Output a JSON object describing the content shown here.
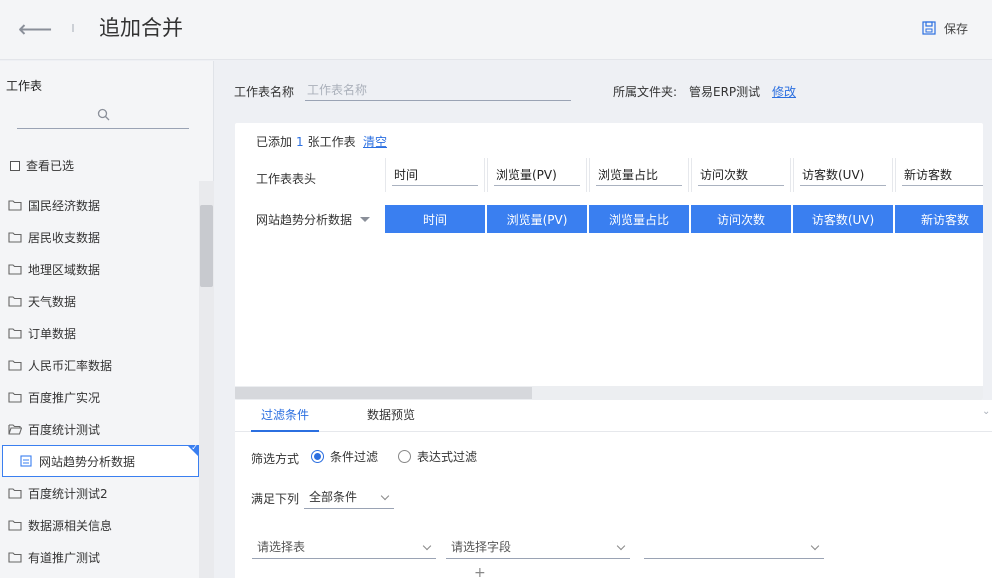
{
  "header": {
    "title": "追加合并",
    "save_label": "保存"
  },
  "sidebar": {
    "title": "工作表",
    "view_checked_label": "查看已选",
    "items": [
      {
        "label": "国民经济数据",
        "type": "folder"
      },
      {
        "label": "居民收支数据",
        "type": "folder"
      },
      {
        "label": "地理区域数据",
        "type": "folder"
      },
      {
        "label": "天气数据",
        "type": "folder"
      },
      {
        "label": "订单数据",
        "type": "folder"
      },
      {
        "label": "人民币汇率数据",
        "type": "folder"
      },
      {
        "label": "百度推广实况",
        "type": "folder"
      },
      {
        "label": "百度统计测试",
        "type": "folder-open"
      },
      {
        "label": "网站趋势分析数据",
        "type": "sheet",
        "selected": true
      },
      {
        "label": "百度统计测试2",
        "type": "folder"
      },
      {
        "label": "数据源相关信息",
        "type": "folder"
      },
      {
        "label": "有道推广测试",
        "type": "folder"
      }
    ]
  },
  "form": {
    "name_label": "工作表名称",
    "name_placeholder": "工作表名称",
    "folder_label": "所属文件夹:",
    "folder_name": "管易ERP测试",
    "folder_edit": "修改"
  },
  "merge": {
    "added_prefix": "已添加",
    "added_count": "1",
    "added_suffix": "张工作表",
    "clear_label": "清空",
    "header_label": "工作表表头",
    "header_columns": [
      "时间",
      "浏览量(PV)",
      "浏览量占比",
      "访问次数",
      "访客数(UV)",
      "新访客数"
    ],
    "sheet_name": "网站趋势分析数据",
    "sheet_fields": [
      "时间",
      "浏览量(PV)",
      "浏览量占比",
      "访问次数",
      "访客数(UV)",
      "新访客数"
    ]
  },
  "tabs": {
    "filter": "过滤条件",
    "preview": "数据预览"
  },
  "filter": {
    "mode_label": "筛选方式",
    "mode_condition": "条件过滤",
    "mode_expression": "表达式过滤",
    "satisfy_label": "满足下列",
    "satisfy_value": "全部条件",
    "table_placeholder": "请选择表",
    "field_placeholder": "请选择字段",
    "add_symbol": "+"
  },
  "colors": {
    "accent": "#3a7ff0",
    "link": "#2b6fe0"
  }
}
